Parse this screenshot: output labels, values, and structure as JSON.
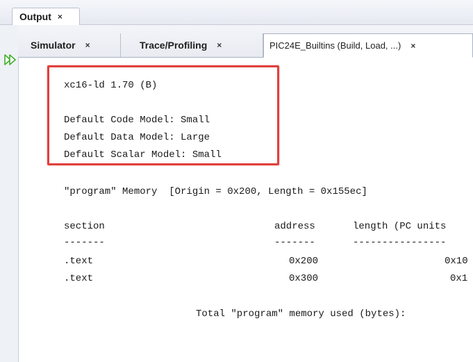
{
  "output_panel": {
    "tab_label": "Output",
    "tab_close": "×"
  },
  "subtabs": [
    {
      "label": "Simulator",
      "close": "×"
    },
    {
      "label": "Trace/Profiling",
      "close": "×"
    },
    {
      "label": "PIC24E_Builtins (Build, Load, ...)",
      "close": "×"
    }
  ],
  "console": {
    "version_line": "xc16-ld 1.70 (B)",
    "code_model": "Default Code Model: Small",
    "data_model": "Default Data Model: Large",
    "scalar_model": "Default Scalar Model: Small",
    "memory_header": "\"program\" Memory  [Origin = 0x200, Length = 0x155ec]",
    "col_section": "section",
    "col_address": "address",
    "col_length": "length (PC units",
    "sep_section": "-------",
    "sep_address": "-------",
    "sep_length": "----------------",
    "rows": [
      {
        "section": ".text",
        "address": "0x200",
        "length": "0x10"
      },
      {
        "section": ".text",
        "address": "0x300",
        "length": "0x1"
      }
    ],
    "total_line": "Total \"program\" memory used (bytes):"
  },
  "colors": {
    "highlight": "#e0403c",
    "rerun_icon": "#3fae2a"
  },
  "icons": {
    "rerun": "double-play-icon"
  }
}
